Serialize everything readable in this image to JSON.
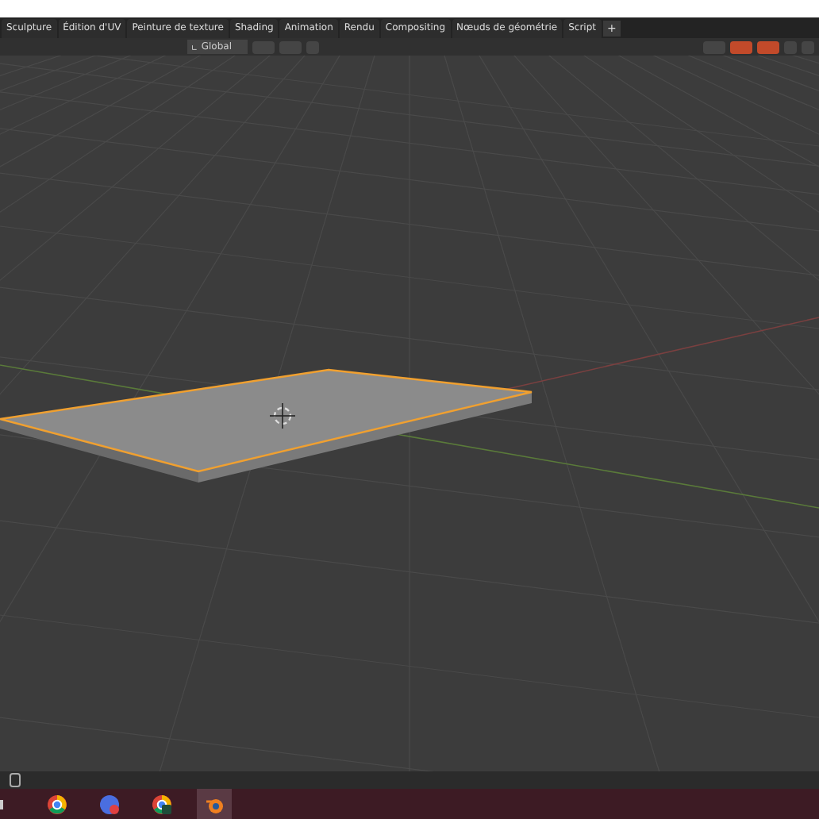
{
  "workspace_tabs": [
    {
      "label": "Sculpture"
    },
    {
      "label": "Édition d'UV"
    },
    {
      "label": "Peinture de texture"
    },
    {
      "label": "Shading"
    },
    {
      "label": "Animation"
    },
    {
      "label": "Rendu"
    },
    {
      "label": "Compositing"
    },
    {
      "label": "Nœuds de géométrie"
    },
    {
      "label": "Script"
    }
  ],
  "add_tab": "+",
  "header": {
    "orientation": "Global"
  },
  "viewport": {
    "object_selected": true
  },
  "taskbar": {
    "apps": [
      {
        "kind": "browser",
        "selected": false
      },
      {
        "kind": "chat",
        "selected": false
      },
      {
        "kind": "browser-badge",
        "selected": false
      },
      {
        "kind": "blender",
        "selected": true
      }
    ]
  }
}
